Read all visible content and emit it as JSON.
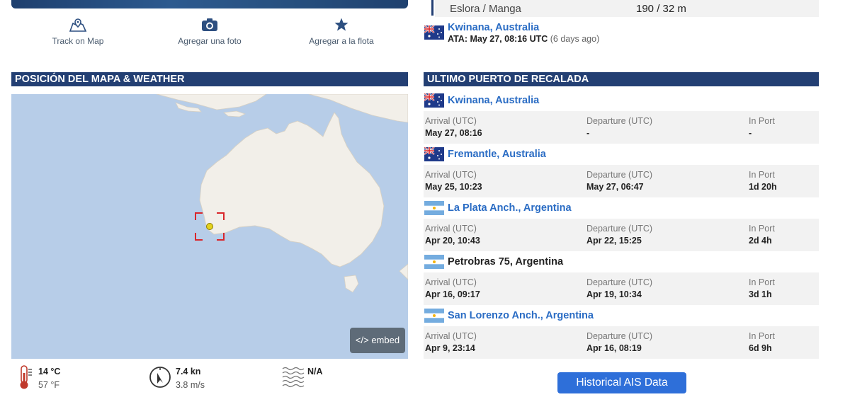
{
  "actions": {
    "track": "Track on Map",
    "photo": "Agregar una foto",
    "fleet": "Agregar a la flota"
  },
  "map_section": {
    "title": "POSICIÓN DEL MAPA & WEATHER",
    "embed_label": "</> embed"
  },
  "weather": {
    "temp_c": "14 °C",
    "temp_f": "57 °F",
    "wind_kn": "7.4 kn",
    "wind_ms": "3.8 m/s",
    "wave": "N/A"
  },
  "vessel": {
    "dim_label": "Eslora / Manga",
    "dim_value": "190 / 32 m"
  },
  "destination": {
    "name": "Kwinana, Australia",
    "ata_label": "ATA:",
    "ata_value": "May 27, 08:16 UTC",
    "ago": "(6 days ago)",
    "flag": "australia"
  },
  "ports_section": {
    "title": "ULTIMO PUERTO DE RECALADA",
    "col_arrival": "Arrival (UTC)",
    "col_departure": "Departure (UTC)",
    "col_inport": "In Port",
    "ports": [
      {
        "name": "Kwinana, Australia",
        "flag": "australia",
        "link": true,
        "arrival": "May 27, 08:16",
        "departure": "-",
        "inport": "-"
      },
      {
        "name": "Fremantle, Australia",
        "flag": "australia",
        "link": true,
        "arrival": "May 25, 10:23",
        "departure": "May 27, 06:47",
        "inport": "1d 20h"
      },
      {
        "name": "La Plata Anch., Argentina",
        "flag": "argentina",
        "link": true,
        "arrival": "Apr 20, 10:43",
        "departure": "Apr 22, 15:25",
        "inport": "2d 4h"
      },
      {
        "name": "Petrobras 75, Argentina",
        "flag": "argentina",
        "link": false,
        "arrival": "Apr 16, 09:17",
        "departure": "Apr 19, 10:34",
        "inport": "3d 1h"
      },
      {
        "name": "San Lorenzo Anch., Argentina",
        "flag": "argentina",
        "link": true,
        "arrival": "Apr 9, 23:14",
        "departure": "Apr 16, 08:19",
        "inport": "6d 9h"
      }
    ]
  },
  "historical_button": "Historical AIS Data",
  "colors": {
    "header_bg": "#233f73",
    "link": "#2a6cc4",
    "button": "#2e6fd9",
    "ocean": "#b7cde8",
    "land": "#f2efe9",
    "marker": "#e5d21d",
    "target_box": "#d9262b"
  }
}
